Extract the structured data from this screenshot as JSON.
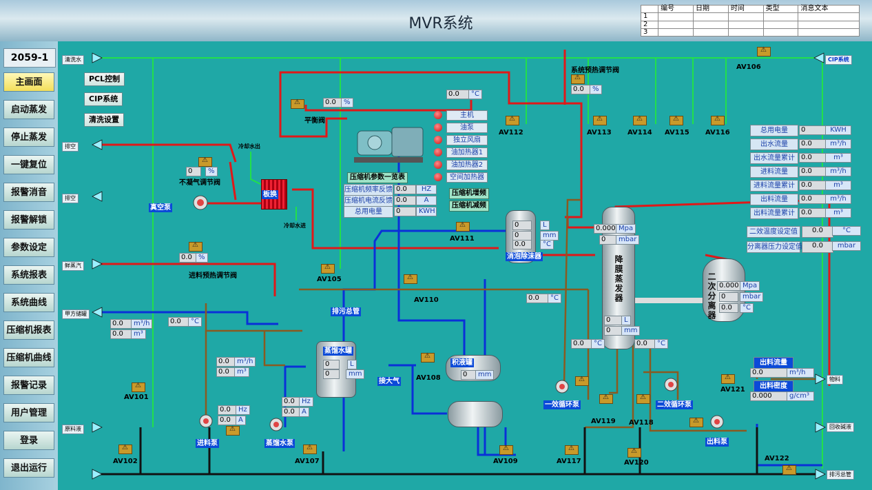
{
  "header": {
    "title": "MVR系统"
  },
  "msg_table": {
    "headers": [
      "",
      "编号",
      "日期",
      "时间",
      "类型",
      "消息文本"
    ],
    "rows": [
      "1",
      "2",
      "3"
    ]
  },
  "sidebar": {
    "station_id": "2059-1",
    "items": [
      "主画面",
      "启动蒸发",
      "停止蒸发",
      "一键复位",
      "报警消音",
      "报警解锁",
      "参数设定",
      "系统报表",
      "系统曲线",
      "压缩机报表",
      "压缩机曲线",
      "报警记录",
      "用户管理",
      "登录",
      "退出运行"
    ]
  },
  "controls": {
    "pcl": "PCL控制",
    "cip": "CIP系统",
    "wash": "清洗设置"
  },
  "edge_tags": {
    "clean_water": "清洗水",
    "vent1": "排空",
    "vent2": "排空",
    "steam": "鲜蒸汽",
    "customer": "甲方储罐",
    "raw": "原料液",
    "cip_sys": "CIP系统",
    "product": "物料",
    "recycle": "回收碱液",
    "drain_main": "排污总管"
  },
  "valves": {
    "av101": "AV101",
    "av102": "AV102",
    "av105": "AV105",
    "av106": "AV106",
    "av107": "AV107",
    "av108": "AV108",
    "av109": "AV109",
    "av110": "AV110",
    "av111": "AV111",
    "av112": "AV112",
    "av113": "AV113",
    "av114": "AV114",
    "av115": "AV115",
    "av116": "AV116",
    "av117": "AV117",
    "av118": "AV118",
    "av119": "AV119",
    "av120": "AV120",
    "av121": "AV121",
    "av122": "AV122"
  },
  "labels": {
    "balance_valve": "平衡阀",
    "noncond_valve": "不凝气调节阀",
    "vacuum_pump": "真空泵",
    "plate_hx": "板换",
    "cool_out": "冷却水出",
    "cool_in": "冷却水进",
    "feed_preheat": "进料预热调节阀",
    "drain_pipe": "排污总管",
    "sys_preheat": "系统预热调节阀",
    "defoamer": "消泡除沫器",
    "evap1": "降",
    "evap2": "膜",
    "evap3": "蒸",
    "evap4": "发",
    "evap5": "器",
    "sep1": "二",
    "sep2": "次",
    "sep3": "分",
    "sep4": "离",
    "sep5": "器",
    "distill_tank": "蒸馏水罐",
    "collect_tank": "积液罐",
    "to_air": "接大气",
    "feed_pump": "进料泵",
    "distill_pump": "蒸馏水泵",
    "circ1": "一效循环泵",
    "circ2": "二效循环泵",
    "out_pump": "出料泵"
  },
  "compressor": {
    "status": [
      "主机",
      "油泵",
      "独立风扇",
      "油加热器1",
      "油加热器2",
      "空间加热器"
    ],
    "overview": "压缩机参数一览表",
    "rows": [
      {
        "name": "压缩机频率反馈",
        "val": "0.0",
        "unit": "HZ"
      },
      {
        "name": "压缩机电流反馈",
        "val": "0.0",
        "unit": "A"
      },
      {
        "name": "总用电量",
        "val": "0",
        "unit": "KWH"
      }
    ],
    "up": "压缩机增频",
    "down": "压缩机减频"
  },
  "values": {
    "balance_pct": "0.0",
    "balance_unit": "%",
    "noncond_pct": "0",
    "noncond_unit": "%",
    "feed_pct": "0.0",
    "feed_unit": "%",
    "top_temp": "0.0",
    "top_temp_unit": "°C",
    "sys_pct": "0.0",
    "sys_unit": "%",
    "def_l": "0",
    "def_l_u": "L",
    "def_mm": "0",
    "def_mm_u": "mm",
    "def_c": "0.0",
    "def_c_u": "°C",
    "ev_mpa": "0.000",
    "ev_mpa_u": "Mpa",
    "ev_mbar": "0",
    "ev_mbar_u": "mbar",
    "ev_l": "0",
    "ev_l_u": "L",
    "ev_mm": "0",
    "ev_mm_u": "mm",
    "sep_mpa": "0.000",
    "sep_mpa_u": "Mpa",
    "sep_mbar": "0",
    "sep_mbar_u": "mbar",
    "sep_c": "0.0",
    "sep_c_u": "°C",
    "t110": "0.0",
    "t110_u": "°C",
    "tev_l": "0.0",
    "tev_l_u": "°C",
    "tev_r": "0.0",
    "tev_r_u": "°C",
    "tcust": "0.0",
    "tcust_u": "°C",
    "cust_flow": "0.0",
    "cust_flow_u": "m³/h",
    "cust_tot": "0.0",
    "cust_tot_u": "m³",
    "feed_flow": "0.0",
    "feed_flow_u": "m³/h",
    "feed_tot": "0.0",
    "feed_tot_u": "m³",
    "fp_hz": "0.0",
    "fp_hz_u": "Hz",
    "fp_a": "0.0",
    "fp_a_u": "A",
    "dp_hz": "0.0",
    "dp_hz_u": "Hz",
    "dp_a": "0.0",
    "dp_a_u": "A",
    "dt_l": "0",
    "dt_l_u": "L",
    "dt_mm": "0",
    "dt_mm_u": "mm",
    "ct_mm": "0",
    "ct_mm_u": "mm",
    "out_flow_label": "出料流量",
    "out_flow": "0.0",
    "out_flow_u": "m³/h",
    "out_dens_label": "出料密度",
    "out_dens": "0.000",
    "out_dens_u": "g/cm³"
  },
  "stats": [
    {
      "name": "总用电量",
      "val": "0",
      "unit": "KWH"
    },
    {
      "name": "出水流量",
      "val": "0.0",
      "unit": "m³/h"
    },
    {
      "name": "出水流量累计",
      "val": "0.0",
      "unit": "m³"
    },
    {
      "name": "进料流量",
      "val": "0.0",
      "unit": "m³/h"
    },
    {
      "name": "进料流量累计",
      "val": "0.0",
      "unit": "m³"
    },
    {
      "name": "出料流量",
      "val": "0.0",
      "unit": "m³/h"
    },
    {
      "name": "出料流量累计",
      "val": "0.0",
      "unit": "m³"
    }
  ],
  "setpoints": [
    {
      "name": "二效温度设定值",
      "val": "0.0",
      "unit": "°C"
    },
    {
      "name": "分离器压力设定值",
      "val": "0.0",
      "unit": "mbar"
    }
  ]
}
